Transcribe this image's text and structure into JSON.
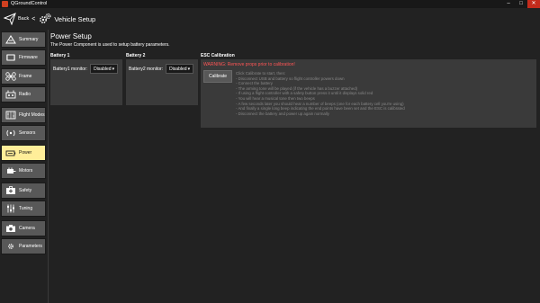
{
  "window": {
    "title": "QGroundControl"
  },
  "toolbar": {
    "back_label": "Back",
    "back_chevron": "<",
    "title": "Vehicle Setup"
  },
  "sidebar": {
    "items": [
      {
        "label": "Summary",
        "icon": "summary-icon"
      },
      {
        "label": "Firmware",
        "icon": "firmware-icon"
      },
      {
        "label": "Frame",
        "icon": "frame-icon"
      },
      {
        "label": "Radio",
        "icon": "radio-icon"
      },
      {
        "label": "Flight Modes",
        "icon": "flight-modes-icon"
      },
      {
        "label": "Sensors",
        "icon": "sensors-icon"
      },
      {
        "label": "Power",
        "icon": "power-icon",
        "active": true
      },
      {
        "label": "Motors",
        "icon": "motors-icon"
      },
      {
        "label": "Safety",
        "icon": "safety-icon"
      },
      {
        "label": "Tuning",
        "icon": "tuning-icon"
      },
      {
        "label": "Camera",
        "icon": "camera-icon"
      },
      {
        "label": "Parameters",
        "icon": "parameters-icon"
      }
    ]
  },
  "main": {
    "title": "Power Setup",
    "description": "The Power Component is used to setup battery parameters.",
    "battery1": {
      "heading": "Battery 1",
      "monitor_label": "Battery1 monitor:",
      "monitor_value": "Disabled"
    },
    "battery2": {
      "heading": "Battery 2",
      "monitor_label": "Battery2 monitor:",
      "monitor_value": "Disabled"
    },
    "esc": {
      "heading": "ESC Calibration",
      "warning": "WARNING: Remove props prior to calibration!",
      "calibrate_label": "Calibrate",
      "instructions": [
        "Click Calibrate to start, then:",
        "- Disconnect USB and battery so flight controller powers down",
        "- Connect the battery",
        "- The arming tone will be played (if the vehicle has a buzzer attached)",
        "- If using a flight controller with a safety button press it until it displays solid red",
        "- You will hear a musical tone then two beeps",
        "- A few seconds later you should hear a number of beeps (one for each battery cell you're using)",
        "- And finally a single long beep indicating the end points have been set and the ESC is calibrated",
        "- Disconnect the battery and power up again normally"
      ]
    }
  },
  "colors": {
    "accent": "#ffee99",
    "warning": "#ff5555",
    "panel": "#3a3a3a",
    "background": "#222222"
  }
}
